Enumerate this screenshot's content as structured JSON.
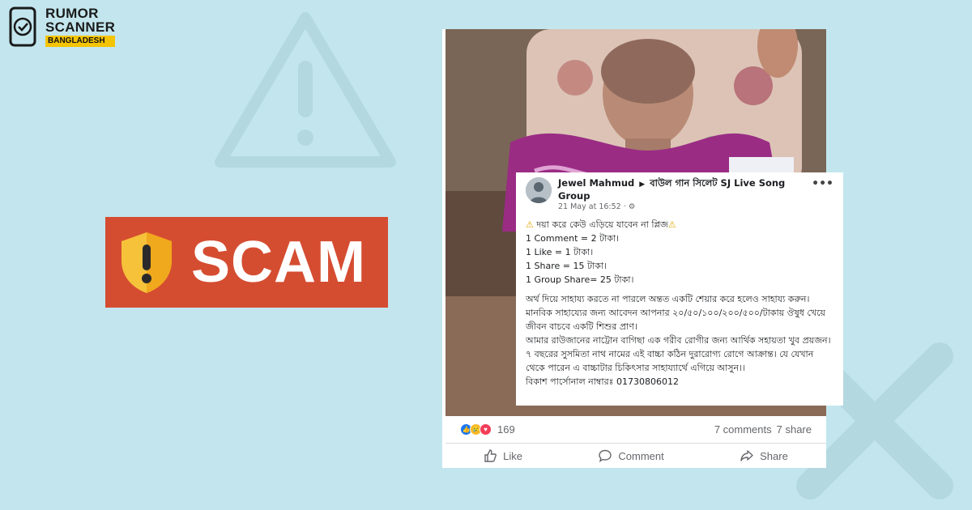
{
  "brand": {
    "line1": "RUMOR",
    "line2": "SCANNER",
    "badge": "BANGLADESH"
  },
  "banner": {
    "label": "SCAM",
    "color": "#d54d31"
  },
  "post": {
    "author": "Jewel Mahmud",
    "group": "বাউল গান সিলেট SJ Live Song Group",
    "time": "21 May at 16:52 ·",
    "more": "•••",
    "lines": {
      "l1": "দয়া করে কেউ এড়িয়ে যাবেন না প্লিজ",
      "l2": "1 Comment = 2 টাকা।",
      "l3": "1 Like = 1 টাকা।",
      "l4": "1 Share = 15 টাকা।",
      "l5": "1 Group Share= 25 টাকা।",
      "l6": "অর্থ দিয়ে সাহায্য করতে না পারলে অন্তত একটি শেয়ার করে হলেও সাহায্য করুন।",
      "l7": "মানবিক সাহায্যের জন্য আবেদন আপনার ২০/৫০/১০০/২০০/৫০০/টাকায় ঔষুধ খেয়ে জীবন বাচবে একটি শিশুর প্রাণ।",
      "l8": "আমার রাউজানের নাট্টোন বাগিছা এক গরীব রোগীর জন্য আর্থিক সহায়তা খুব প্রয়জন। ৭ বছরের সুসমিতা নাথ নামের এই বাচ্চা কঠিন দুরারোগ্য রোগে আক্রান্ত। যে যেখান থেকে পারেন এ বাচ্চাটার চিকিৎসার সাহায্যার্থে এগিয়ে আসুন।।",
      "l9": "বিকাশ পার্সোনাল নাম্বারঃ 01730806012"
    }
  },
  "stats": {
    "reaction_count": "169",
    "comments": "7 comments",
    "shares": "7 share"
  },
  "actions": {
    "like": "Like",
    "comment": "Comment",
    "share": "Share"
  }
}
